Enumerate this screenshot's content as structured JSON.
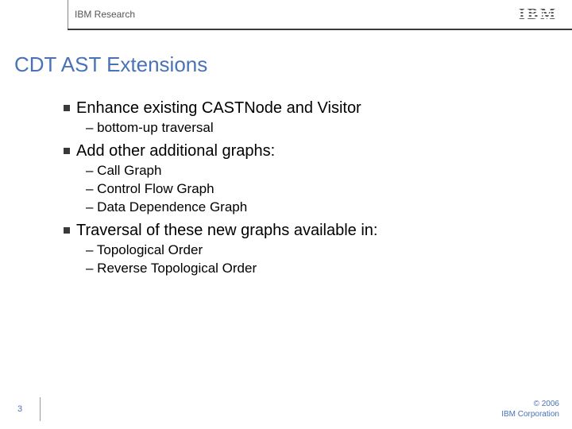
{
  "header": {
    "org": "IBM Research",
    "logo_text": "IBM"
  },
  "title": "CDT AST Extensions",
  "bullets": [
    {
      "text": "Enhance existing CASTNode and Visitor",
      "subs": [
        "– bottom-up traversal"
      ]
    },
    {
      "text": "Add other additional graphs:",
      "subs": [
        "– Call Graph",
        "– Control Flow Graph",
        "– Data Dependence Graph"
      ]
    },
    {
      "text": "Traversal of these new graphs available in:",
      "subs": [
        "– Topological Order",
        "– Reverse Topological Order"
      ]
    }
  ],
  "footer": {
    "page": "3",
    "copyright": "© 2006",
    "corp": "IBM Corporation"
  }
}
